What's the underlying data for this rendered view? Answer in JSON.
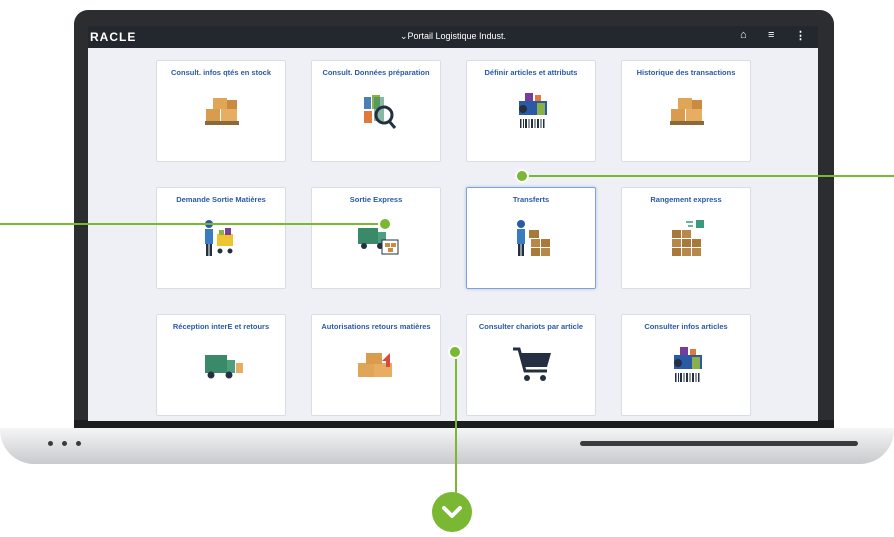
{
  "header": {
    "logo": "RACLE",
    "portal_title": "⌄Portail Logistique Indust.",
    "home_icon": "⌂",
    "list_icon": "≡",
    "more_icon": "⋮"
  },
  "tiles": [
    {
      "label": "Consult. infos qtés en stock",
      "icon": "boxes-pallet-icon"
    },
    {
      "label": "Consult. Données préparation",
      "icon": "magnifier-icon"
    },
    {
      "label": "Définir articles et attributs",
      "icon": "items-barcode-icon"
    },
    {
      "label": "Historique des transactions",
      "icon": "boxes-pallet-icon"
    },
    {
      "label": "Demande Sortie Matières",
      "icon": "person-cart-icon"
    },
    {
      "label": "Sortie Express",
      "icon": "truck-boxes-icon"
    },
    {
      "label": "Transferts",
      "icon": "person-boxes-icon"
    },
    {
      "label": "Rangement express",
      "icon": "boxes-stack-icon"
    },
    {
      "label": "Réception interE et retours",
      "icon": "truck-icon"
    },
    {
      "label": "Autorisations retours matières",
      "icon": "return-boxes-icon"
    },
    {
      "label": "Consulter chariots par article",
      "icon": "shopping-cart-icon"
    },
    {
      "label": "Consulter infos articles",
      "icon": "items-barcode-icon"
    }
  ],
  "colors": {
    "accent": "#7ab833",
    "tile_label": "#2a5aa6",
    "topbar": "#23272e"
  }
}
